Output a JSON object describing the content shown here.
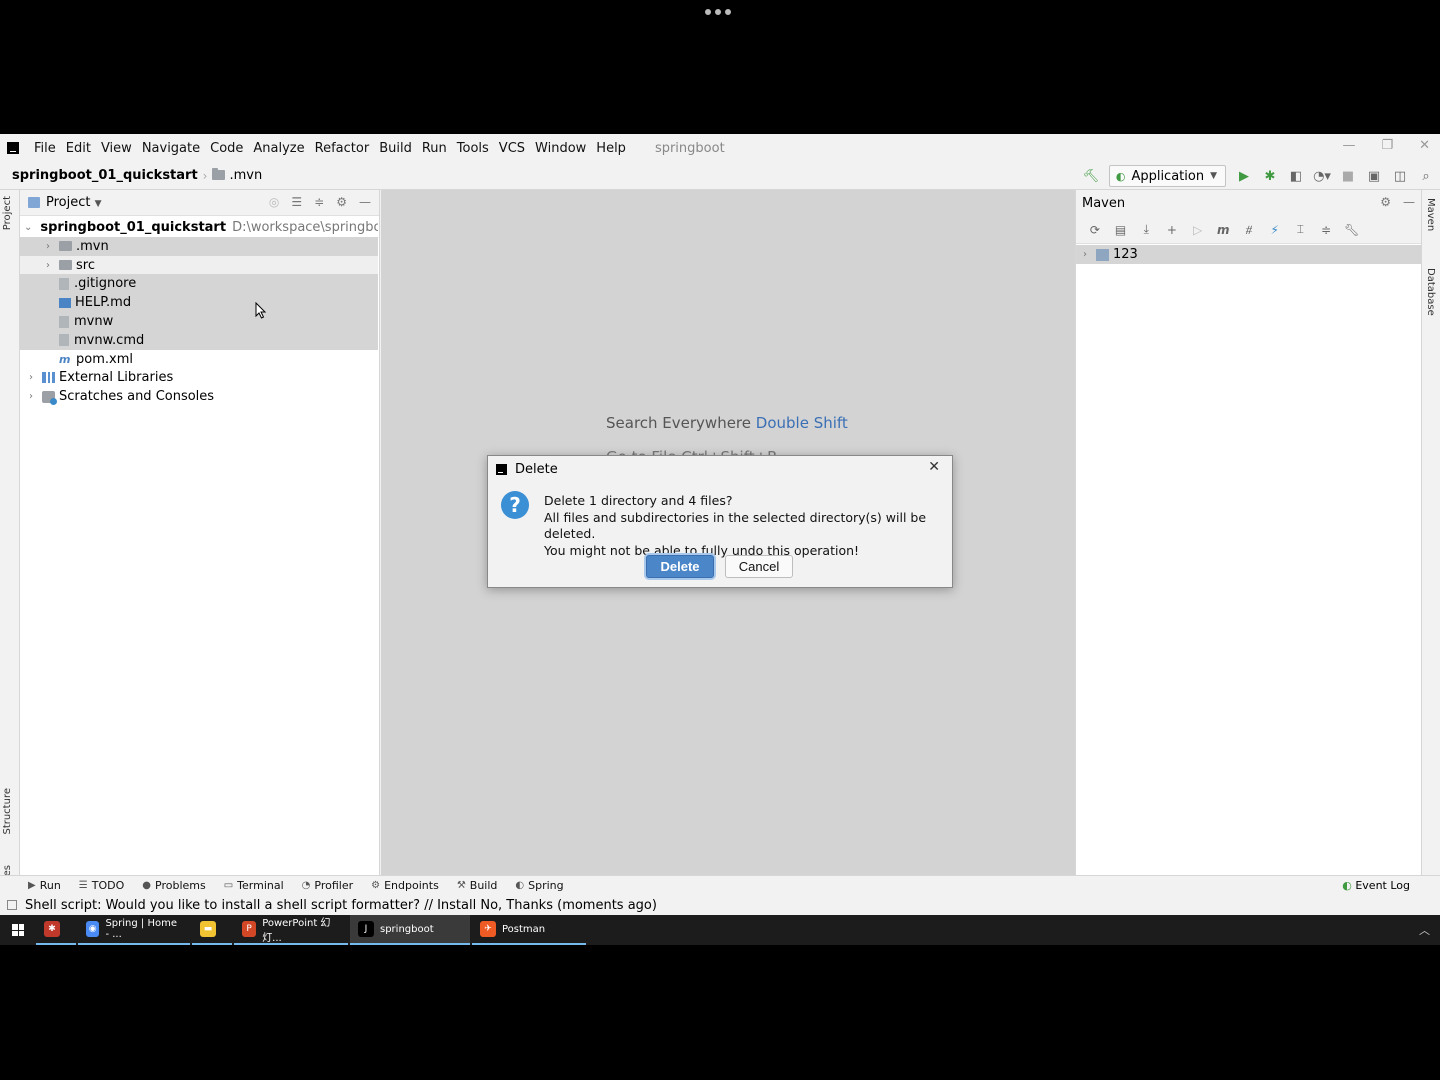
{
  "menu": {
    "items": [
      "File",
      "Edit",
      "View",
      "Navigate",
      "Code",
      "Analyze",
      "Refactor",
      "Build",
      "Run",
      "Tools",
      "VCS",
      "Window",
      "Help"
    ],
    "window_title": "springboot"
  },
  "navbar": {
    "project": "springboot_01_quickstart",
    "folder": ".mvn",
    "run_config": "Application"
  },
  "stripes": {
    "left": [
      "Project",
      "Structure",
      "Favorites"
    ],
    "right": [
      "Maven",
      "Database"
    ]
  },
  "project_panel": {
    "title": "Project",
    "tree": [
      {
        "label": "springboot_01_quickstart",
        "path": "D:\\workspace\\springboot\\s",
        "bold": true,
        "level": 0,
        "icon": "module-icon",
        "expand": "down"
      },
      {
        "label": ".mvn",
        "level": 1,
        "icon": "folder-icon",
        "expand": "right"
      },
      {
        "label": "src",
        "level": 1,
        "icon": "folder-icon",
        "expand": "right"
      },
      {
        "label": ".gitignore",
        "level": 1,
        "icon": "file-icon",
        "expand": ""
      },
      {
        "label": "HELP.md",
        "level": 1,
        "icon": "markdown-icon",
        "expand": ""
      },
      {
        "label": "mvnw",
        "level": 1,
        "icon": "file-icon",
        "expand": ""
      },
      {
        "label": "mvnw.cmd",
        "level": 1,
        "icon": "file-icon",
        "expand": ""
      },
      {
        "label": "pom.xml",
        "level": 1,
        "icon": "maven-pom-icon",
        "expand": ""
      },
      {
        "label": "External Libraries",
        "level": 0,
        "icon": "library-icon",
        "expand": "right"
      },
      {
        "label": "Scratches and Consoles",
        "level": 0,
        "icon": "scratch-icon",
        "expand": "right"
      }
    ]
  },
  "editor": {
    "hint_label": "Search Everywhere",
    "hint_shortcut": "Double Shift",
    "hint2": "Go to File Ctrl+Shift+R"
  },
  "maven": {
    "title": "Maven",
    "tree_item": "123"
  },
  "bottom_tools": [
    "Run",
    "TODO",
    "Problems",
    "Terminal",
    "Profiler",
    "Endpoints",
    "Build",
    "Spring"
  ],
  "event_log": "Event Log",
  "status": {
    "message": "Shell script: Would you like to install a shell script formatter? // Install    No, Thanks (moments ago)"
  },
  "taskbar": {
    "items": [
      {
        "label": "",
        "icon": "app-icon",
        "color": "#c0392b"
      },
      {
        "label": "Spring | Home - ...",
        "icon": "chrome-icon",
        "color": "#4a8af4"
      },
      {
        "label": "",
        "icon": "explorer-icon",
        "color": "#f1c232"
      },
      {
        "label": "PowerPoint 幻灯...",
        "icon": "powerpoint-icon",
        "color": "#d24726"
      },
      {
        "label": "springboot",
        "icon": "intellij-icon",
        "color": "#000000"
      },
      {
        "label": "Postman",
        "icon": "postman-icon",
        "color": "#ef5b25"
      }
    ]
  },
  "dialog": {
    "title": "Delete",
    "line1": "Delete 1 directory and 4 files?",
    "line2": "All files and subdirectories in the selected directory(s) will be deleted.",
    "line3": "You might not be able to fully undo this operation!",
    "delete_label": "Delete",
    "cancel_label": "Cancel"
  },
  "colors": {
    "accent": "#4a86c8",
    "link": "#3b6fb5",
    "selection": "#d5d5d5"
  }
}
